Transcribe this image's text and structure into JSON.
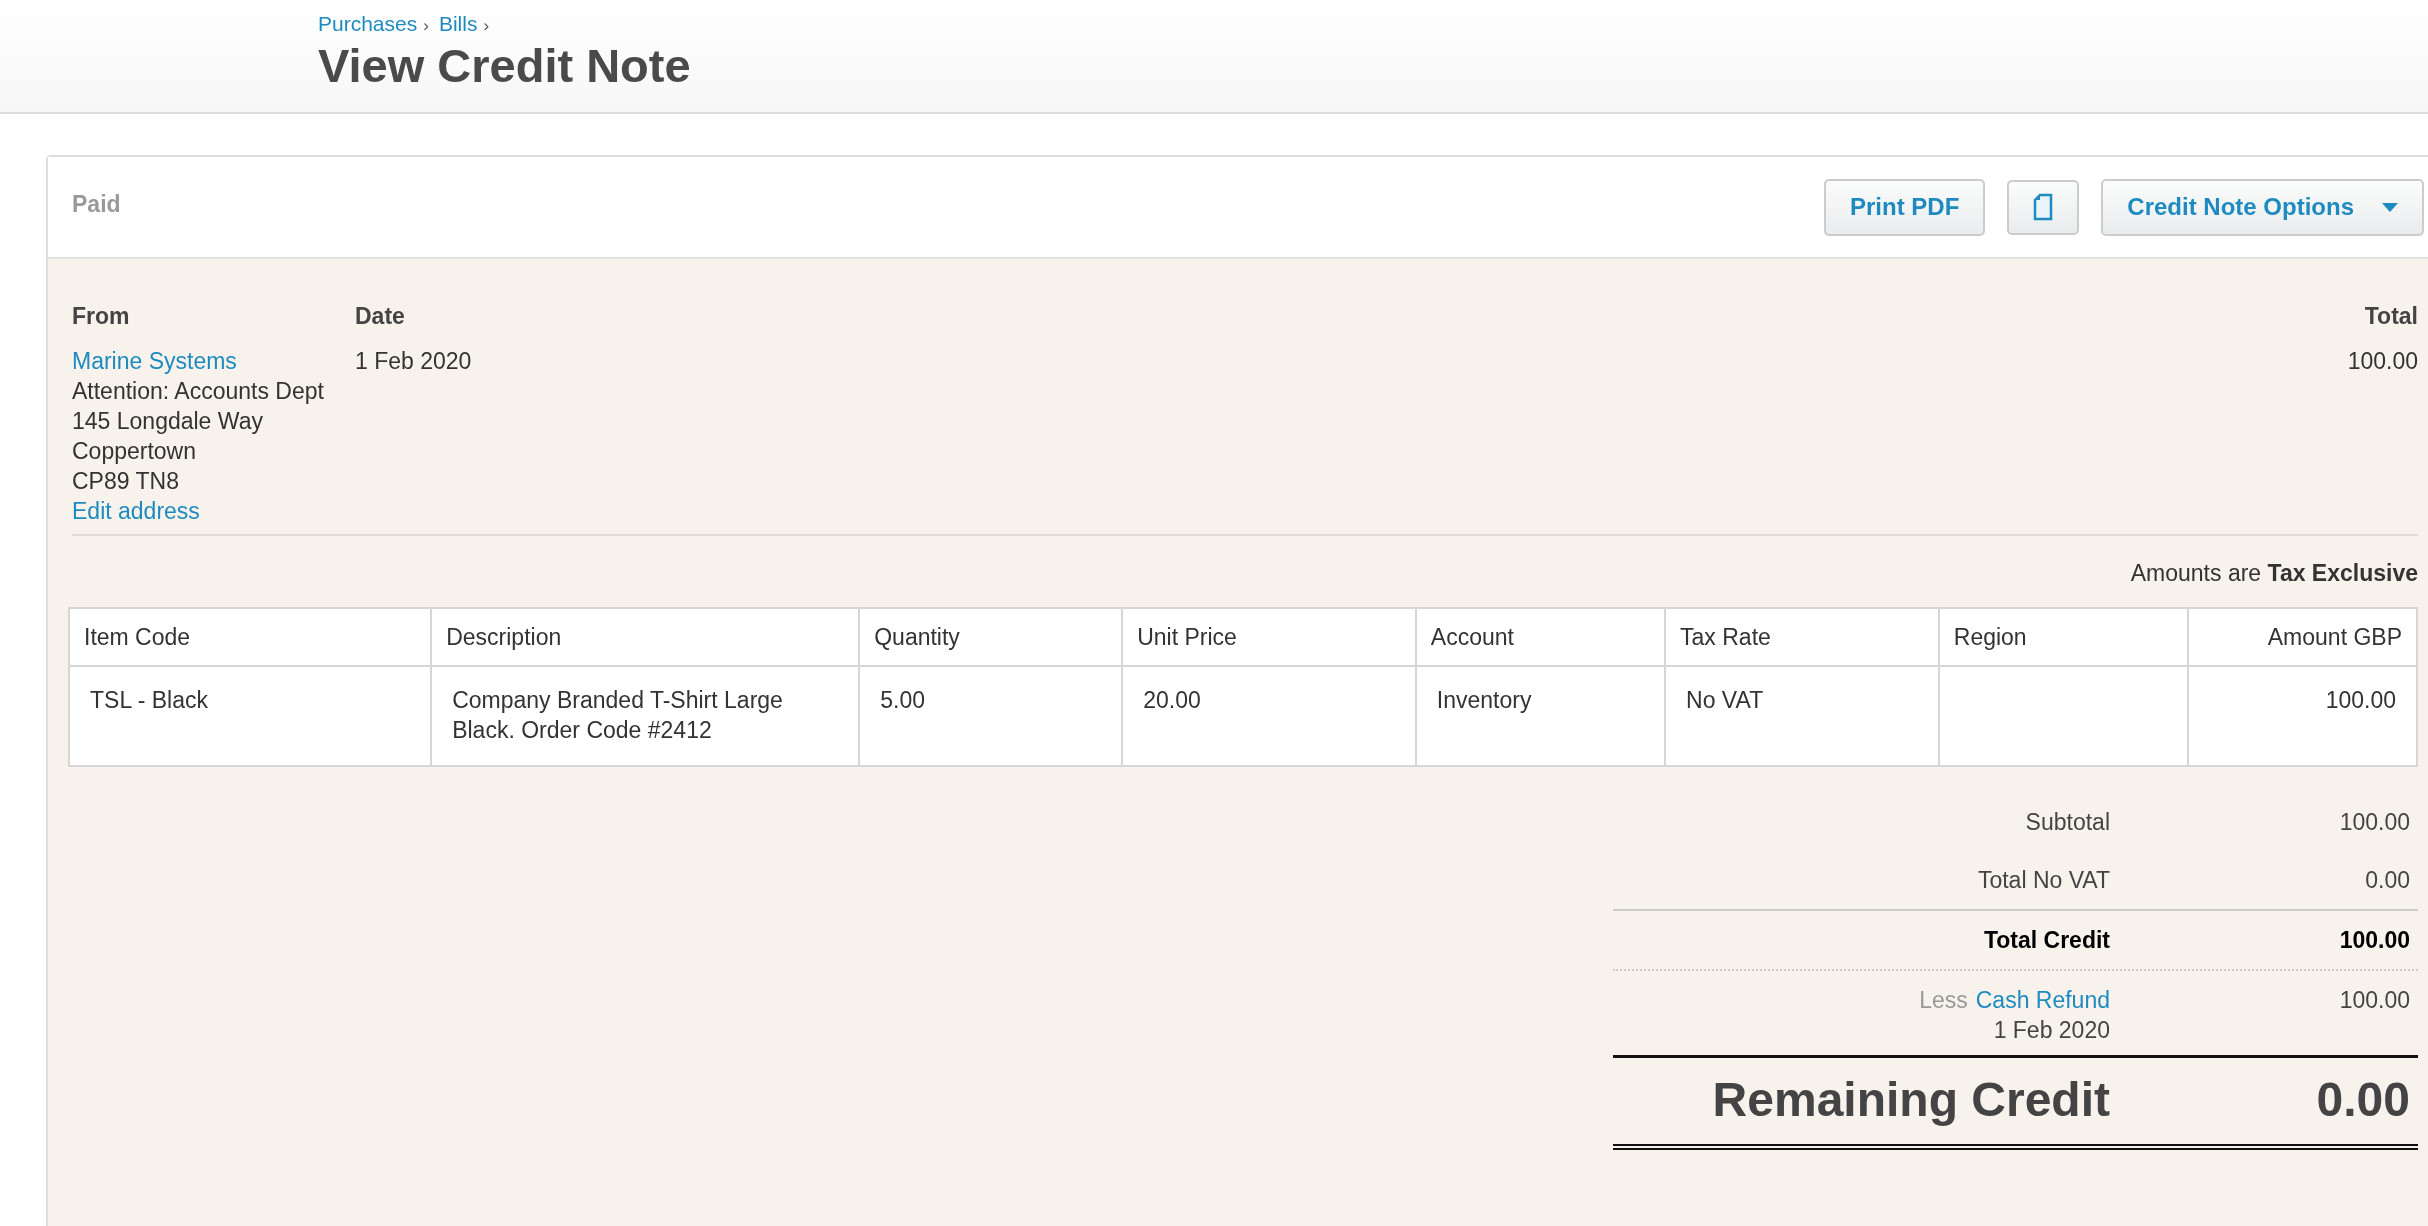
{
  "breadcrumb": {
    "items": [
      "Purchases",
      "Bills"
    ],
    "separator": "›"
  },
  "title": "View Credit Note",
  "status": "Paid",
  "actions": [
    {
      "kind": "text",
      "label": "Print PDF"
    },
    {
      "kind": "icon"
    },
    {
      "kind": "dropdown",
      "label": "Credit Note Options"
    }
  ],
  "from": {
    "heading": "From",
    "name": "Marine Systems",
    "address": [
      "Attention: Accounts Dept",
      "145 Longdale Way",
      "Coppertown",
      "CP89 TN8"
    ],
    "edit_link": "Edit address"
  },
  "date": {
    "heading": "Date",
    "value": "1 Feb 2020"
  },
  "total": {
    "heading": "Total",
    "value": "100.00"
  },
  "amounts_note": "Amounts are **Tax Exclusive**",
  "table": {
    "columns": [
      "Item Code",
      "Description",
      "Quantity",
      "Unit Price",
      "Account",
      "Tax Rate",
      "Region",
      "Amount GBP"
    ],
    "rows": [
      {
        "cells": [
          "TSL - Black",
          "Company Branded T-Shirt Large Black. Order Code #2412",
          "5.00",
          "20.00",
          "Inventory",
          "No VAT",
          "",
          "100.00"
        ]
      }
    ]
  },
  "totals": [
    {
      "kind": "plain",
      "label": "Subtotal",
      "value": "100.00"
    },
    {
      "kind": "plain",
      "label": "Total No VAT",
      "value": "0.00"
    },
    {
      "kind": "strong",
      "label": "Total Credit",
      "value": "100.00"
    },
    {
      "kind": "payment",
      "prefix": "Less",
      "link": "Cash Refund",
      "date": "1 Feb 2020",
      "value": "100.00"
    },
    {
      "kind": "grand",
      "label": "Remaining Credit",
      "value": "0.00"
    }
  ]
}
